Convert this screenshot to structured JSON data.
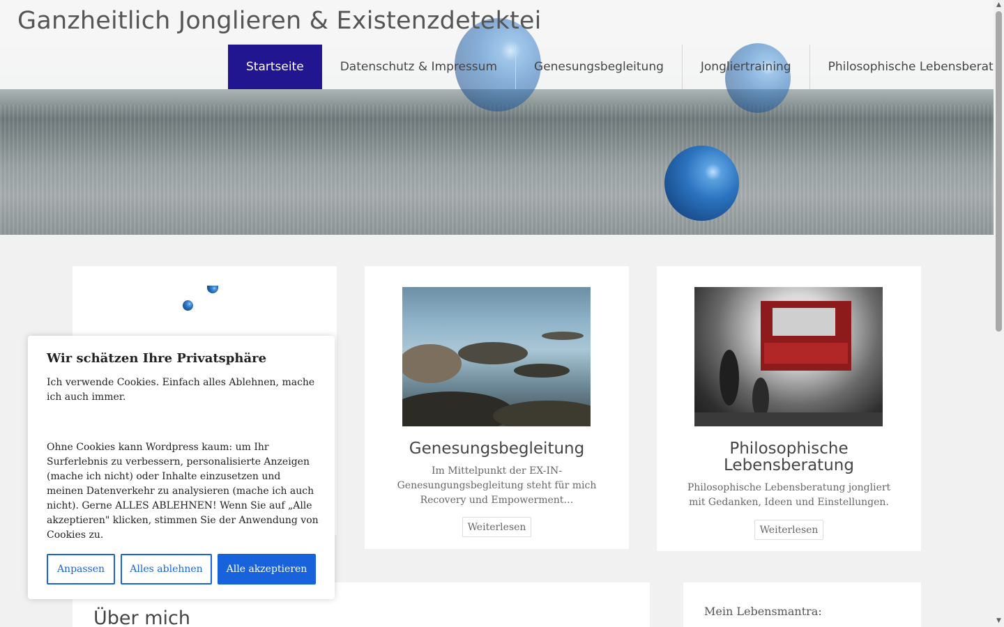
{
  "site": {
    "title": "Ganzheitlich Jonglieren & Existenzdetektei"
  },
  "nav": {
    "items": [
      {
        "label": "Startseite",
        "active": true
      },
      {
        "label": "Datenschutz & Impressum"
      },
      {
        "label": "Genesungsbegleitung"
      },
      {
        "label": "Jongliertraining"
      },
      {
        "label": "Philosophische Lebensberatung"
      }
    ]
  },
  "cards": [
    {
      "title": "",
      "image": "juggling-balls"
    },
    {
      "title": "Genesungsbegleitung",
      "text": "Im Mittelpunkt der EX-IN-Genesungungsbegleitung steht für mich Recovery und Empowerment…",
      "button": "Weiterlesen",
      "image": "stones-in-water"
    },
    {
      "title": "Philosophische Lebensberatung",
      "text": "Philosophische Lebensberatung jongliert mit Gedanken, Ideen und Einstellungen.",
      "button": "Weiterlesen",
      "image": "cave-cinema-illustration"
    }
  ],
  "about": {
    "title": "Über mich"
  },
  "mantra": {
    "label": "Mein Lebensmantra:"
  },
  "cookie": {
    "title": "Wir schätzen Ihre Privatsphäre",
    "text1": "Ich verwende Cookies. Einfach alles Ablehnen, mache ich auch immer.",
    "text2": "Ohne Cookies kann Wordpress kaum: um Ihr Surferlebnis zu verbessern, personalisierte Anzeigen (mache ich nicht) oder Inhalte einzusetzen und meinen Datenverkehr zu analysieren (mache ich auch nicht). Gerne ALLES ABLEHNEN! Wenn Sie auf „Alle akzeptieren\" klicken, stimmen Sie der Anwendung von Cookies zu.",
    "buttons": {
      "customize": "Anpassen",
      "reject": "Alles ablehnen",
      "accept": "Alle akzeptieren"
    }
  },
  "colors": {
    "nav_active": "#21168f",
    "cookie_accent": "#1863dc"
  }
}
